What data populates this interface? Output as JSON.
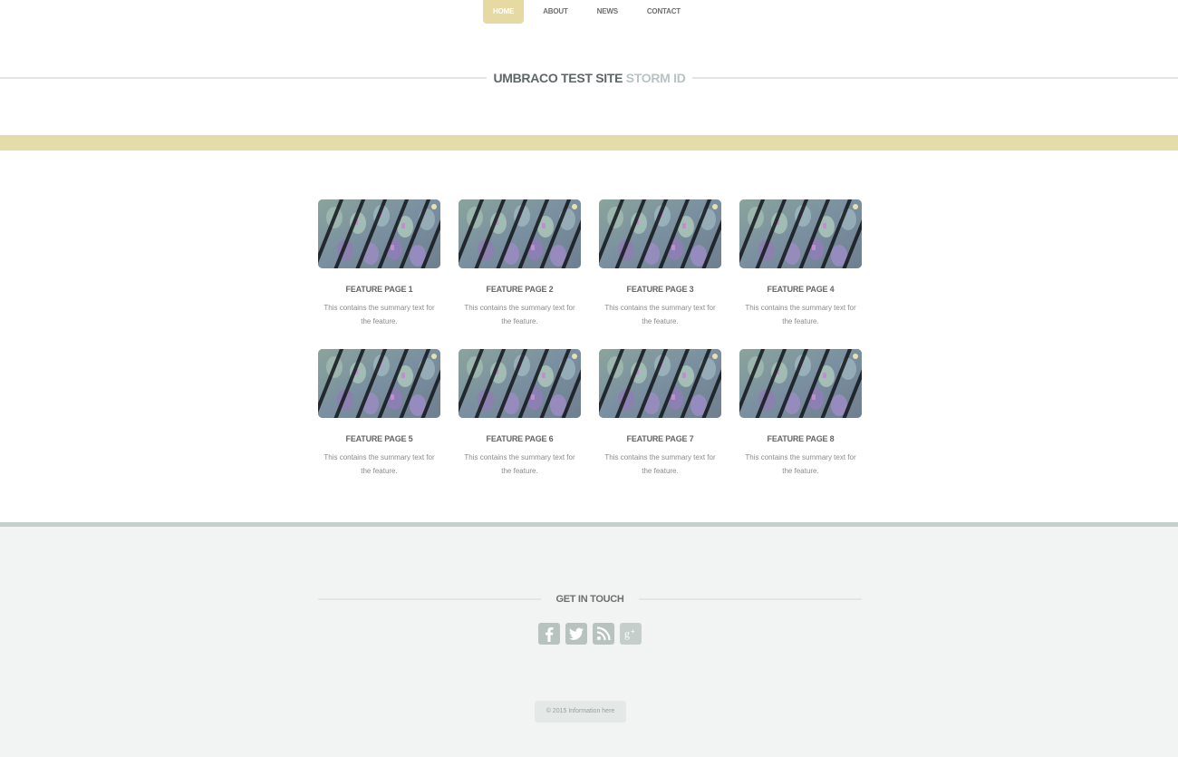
{
  "nav": {
    "items": [
      {
        "label": "HOME",
        "active": true
      },
      {
        "label": "ABOUT",
        "active": false
      },
      {
        "label": "NEWS",
        "active": false
      },
      {
        "label": "CONTACT",
        "active": false
      }
    ]
  },
  "header": {
    "title_main": "UMBRACO TEST SITE",
    "title_accent": "STORM ID"
  },
  "features": [
    {
      "title": "FEATURE PAGE 1",
      "summary": "This contains the summary text for the feature."
    },
    {
      "title": "FEATURE PAGE 2",
      "summary": "This contains the summary text for the feature."
    },
    {
      "title": "FEATURE PAGE 3",
      "summary": "This contains the summary text for the feature."
    },
    {
      "title": "FEATURE PAGE 4",
      "summary": "This contains the summary text for the feature."
    },
    {
      "title": "FEATURE PAGE 5",
      "summary": "This contains the summary text for the feature."
    },
    {
      "title": "FEATURE PAGE 6",
      "summary": "This contains the summary text for the feature."
    },
    {
      "title": "FEATURE PAGE 7",
      "summary": "This contains the summary text for the feature."
    },
    {
      "title": "FEATURE PAGE 8",
      "summary": "This contains the summary text for the feature."
    }
  ],
  "footer": {
    "heading": "GET IN TOUCH",
    "socials": [
      {
        "icon": "facebook-icon"
      },
      {
        "icon": "twitter-icon"
      },
      {
        "icon": "rss-icon"
      },
      {
        "icon": "google-plus-icon"
      }
    ],
    "copyright": "© 2015 Information here"
  },
  "colors": {
    "accent_band": "#e4dca9",
    "nav_active": "#e6d9a2",
    "footer_bg": "#f2f4f3",
    "social_bg": "#b8c2bf"
  }
}
